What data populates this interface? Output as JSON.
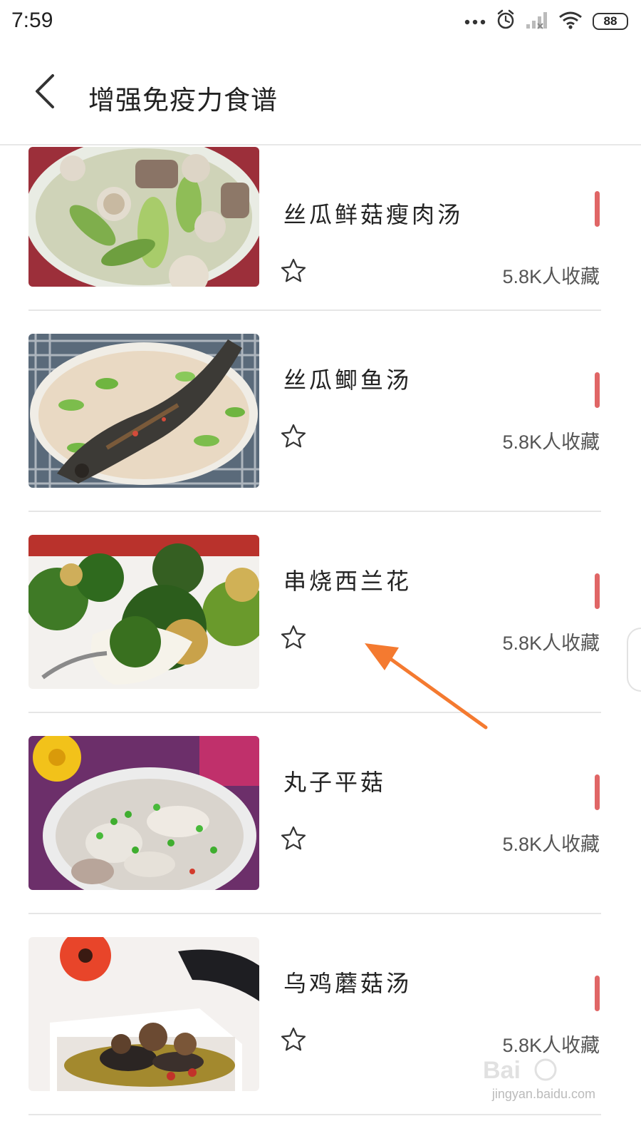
{
  "status_bar": {
    "time": "7:59",
    "battery": "88",
    "icons": [
      "more-dots-icon",
      "alarm-icon",
      "signal-icon",
      "wifi-icon",
      "battery-icon"
    ]
  },
  "header": {
    "title": "增强免疫力食谱",
    "back_icon": "chevron-left-icon"
  },
  "recipes": [
    {
      "name": "丝瓜鲜菇瘦肉汤",
      "count": "5.8K人收藏"
    },
    {
      "name": "丝瓜鲫鱼汤",
      "count": "5.8K人收藏"
    },
    {
      "name": "串烧西兰花",
      "count": "5.8K人收藏"
    },
    {
      "name": "丸子平菇",
      "count": "5.8K人收藏"
    },
    {
      "name": "乌鸡蘑菇汤",
      "count": "5.8K人收藏"
    }
  ],
  "annotation": {
    "arrow_color": "#f47a30",
    "points_to": "串烧西兰花"
  },
  "watermark": {
    "text": "jingyan.baidu.com"
  },
  "colors": {
    "accent_mark": "#e06666",
    "divider": "#e6e6e6"
  }
}
